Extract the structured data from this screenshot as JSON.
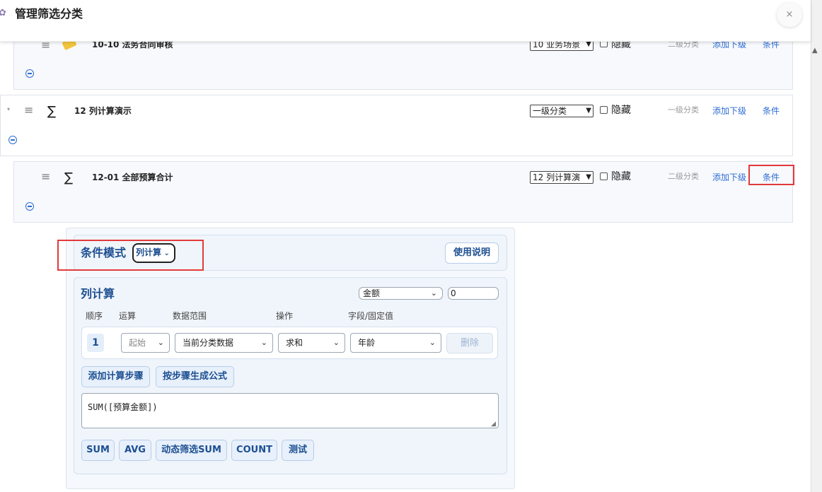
{
  "header": {
    "title": "管理筛选分类",
    "close_label": "×"
  },
  "categories": [
    {
      "code_name": "10-10 法务合同审核",
      "parent_select": "10 业务场景",
      "hide_label": "隐藏",
      "level": "二级分类",
      "add_child": "添加下级",
      "condition": "条件"
    },
    {
      "code_name": "12 列计算演示",
      "parent_select": "一级分类",
      "hide_label": "隐藏",
      "level": "一级分类",
      "add_child": "添加下级",
      "condition": "条件"
    },
    {
      "code_name": "12-01 全部预算合计",
      "parent_select": "12 列计算演",
      "hide_label": "隐藏",
      "level": "二级分类",
      "add_child": "添加下级",
      "condition": "条件"
    }
  ],
  "condition_panel": {
    "mode_label": "条件模式",
    "mode_value": "列计算",
    "help_button": "使用说明",
    "calc_title": "列计算",
    "field_select": "金额",
    "field_value": "0",
    "columns": [
      "顺序",
      "运算",
      "数据范围",
      "操作",
      "字段/固定值"
    ],
    "steps": [
      {
        "order": "1",
        "op": "起始",
        "range": "当前分类数据",
        "action": "求和",
        "field": "年龄",
        "delete": "删除"
      }
    ],
    "add_step": "添加计算步骤",
    "generate_formula": "按步骤生成公式",
    "formula": "SUM([预算金额])",
    "quick_buttons": [
      "SUM",
      "AVG",
      "动态筛选SUM",
      "COUNT",
      "测试"
    ]
  },
  "icons": {
    "gear": "gear-icon",
    "drag": "drag-handle-icon",
    "tag": "tag-icon",
    "sigma": "sigma-icon",
    "collapse": "collapse-minus-icon",
    "chevron": "chevron-down-icon"
  },
  "colors": {
    "accent": "#2d6cd2",
    "panel_title": "#1d4f91",
    "highlight": "#e23a3a"
  }
}
